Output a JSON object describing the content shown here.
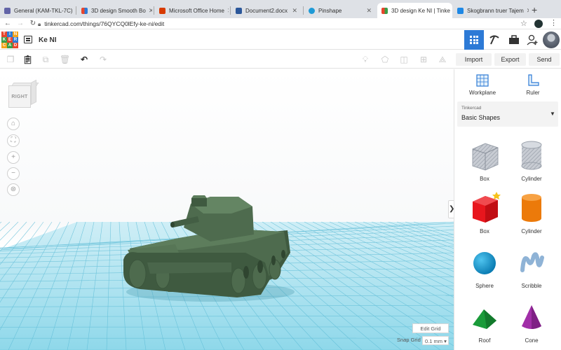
{
  "browser": {
    "tabs": [
      {
        "label": "General (KAM-TKL-7C)",
        "color": "#6264a7",
        "active": false
      },
      {
        "label": "3D design Smooth Bo",
        "color": "#e8452c",
        "active": false
      },
      {
        "label": "Microsoft Office Home",
        "color": "#d83b01",
        "active": false
      },
      {
        "label": "Document2.docx",
        "color": "#2b579a",
        "active": false
      },
      {
        "label": "Pinshape",
        "color": "#1e9ad6",
        "active": false
      },
      {
        "label": "3D design Ke NI | Tinke",
        "color": "#e8452c",
        "active": true
      },
      {
        "label": "Skogbrann truer Tajem",
        "color": "#1e88e5",
        "active": false
      }
    ],
    "new_tab": "+",
    "url": "tinkercad.com/things/76QYCQ0lEfy-ke-ni/edit"
  },
  "header": {
    "logo_letters": [
      "T",
      "I",
      "N",
      "K",
      "E",
      "R",
      "C",
      "A",
      "D"
    ],
    "logo_colors": [
      "#e8452c",
      "#2d7ad6",
      "#f3a41c",
      "#3b9d48",
      "#e8452c",
      "#2d7ad6",
      "#f3a41c",
      "#3b9d48",
      "#e8452c"
    ],
    "design_title": "Ke NI"
  },
  "toolbar": {
    "import": "Import",
    "export": "Export",
    "send_to": "Send To"
  },
  "viewport": {
    "viewcube_face": "RIGHT",
    "edit_grid": "Edit Grid",
    "snap_grid_label": "Snap Grid",
    "snap_grid_value": "0.1 mm ▾",
    "side_handle": "❯",
    "grid_color": "#7fd4e7",
    "tank_color": "#4e6b4e"
  },
  "panel": {
    "workplane": "Workplane",
    "ruler": "Ruler",
    "library_small": "Tinkercad",
    "library_name": "Basic Shapes",
    "shapes": [
      {
        "label": "Box",
        "kind": "box-hole"
      },
      {
        "label": "Cylinder",
        "kind": "cyl-hole"
      },
      {
        "label": "Box",
        "kind": "box-red"
      },
      {
        "label": "Cylinder",
        "kind": "cyl-orange"
      },
      {
        "label": "Sphere",
        "kind": "sphere"
      },
      {
        "label": "Scribble",
        "kind": "scribble"
      },
      {
        "label": "Roof",
        "kind": "roof"
      },
      {
        "label": "Cone",
        "kind": "cone"
      }
    ]
  }
}
